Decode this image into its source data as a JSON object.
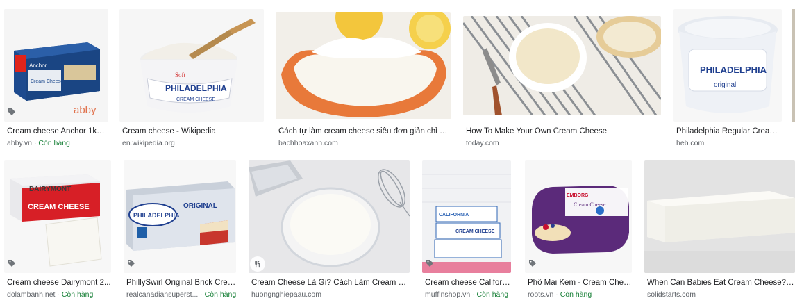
{
  "row1": [
    {
      "title": "Cream cheese Anchor 1kg ...",
      "source": "abby.vn",
      "sep": " · ",
      "stock": "Còn hàng",
      "brand": "Anchor",
      "product": "Cream Cheese",
      "logo": "abby"
    },
    {
      "title": "Cream cheese - Wikipedia",
      "source": "en.wikipedia.org",
      "brand": "PHILADELPHIA",
      "product": "CREAM CHEESE",
      "top": "Soft"
    },
    {
      "title": "Cách tự làm cream cheese siêu đơn giản chỉ với...",
      "source": "bachhoaxanh.com"
    },
    {
      "title": "How To Make Your Own Cream Cheese",
      "source": "today.com"
    },
    {
      "title": "Philadelphia Regular Cream ...",
      "source": "heb.com",
      "brand": "PHILADELPHIA",
      "product": "original"
    }
  ],
  "row2": [
    {
      "title": "Cream cheese Dairymont 2...",
      "source": "dolambanh.net",
      "sep": " · ",
      "stock": "Còn hàng",
      "brand": "DAIRYMONT",
      "product": "CREAM CHEESE"
    },
    {
      "title": "PhillySwirl Original Brick Crea...",
      "source": "realcanadiansuperst...",
      "sep": " · ",
      "stock": "Còn hàng",
      "brand": "PHILADELPHIA",
      "product": "ORIGINAL"
    },
    {
      "title": "Cream Cheese Là Gì? Cách Làm Cream Che...",
      "source": "huongnghiepaau.com"
    },
    {
      "title": "Cream cheese Californi...",
      "source": "muffinshop.vn",
      "sep": " · ",
      "stock": "Còn hàng",
      "brand": "CALIFORNIA",
      "product": "CREAM CHEESE"
    },
    {
      "title": "Phô Mai Kem - Cream Chee...",
      "source": "roots.vn",
      "sep": " · ",
      "stock": "Còn hàng",
      "brand": "EMBORG",
      "product": "Cream Cheese"
    },
    {
      "title": "When Can Babies Eat Cream Cheese? - Sol...",
      "source": "solidstarts.com"
    }
  ],
  "colors": {
    "green_stock": "#188038",
    "source_gray": "#5f6368"
  }
}
